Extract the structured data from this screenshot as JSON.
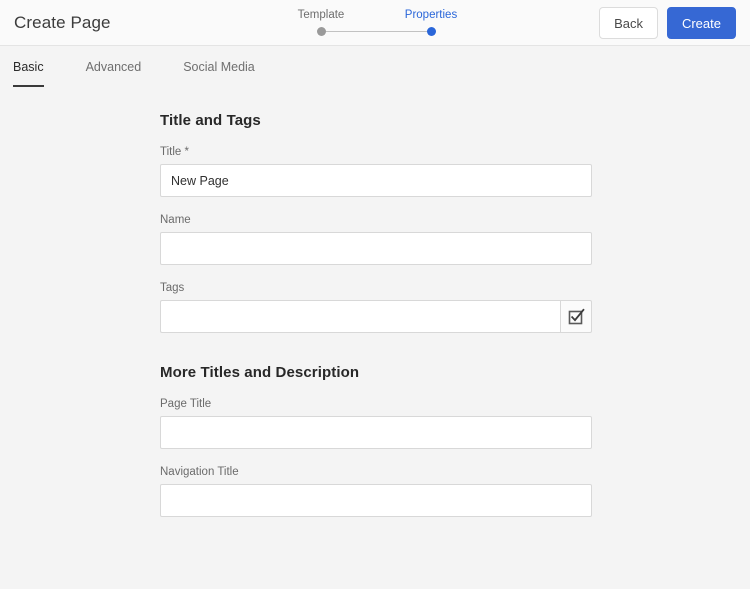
{
  "header": {
    "title": "Create Page",
    "stepper": {
      "steps": [
        {
          "label": "Template",
          "state": "inactive"
        },
        {
          "label": "Properties",
          "state": "active"
        }
      ]
    },
    "actions": {
      "back_label": "Back",
      "create_label": "Create"
    },
    "colors": {
      "primary": "#3668d4",
      "active_step": "#2a66d9",
      "inactive_step": "#9a9a9a"
    }
  },
  "tabs": [
    {
      "label": "Basic",
      "active": true
    },
    {
      "label": "Advanced",
      "active": false
    },
    {
      "label": "Social Media",
      "active": false
    }
  ],
  "form": {
    "sections": [
      {
        "heading": "Title and Tags",
        "fields": [
          {
            "label": "Title *",
            "value": "New Page",
            "placeholder": ""
          },
          {
            "label": "Name",
            "value": "",
            "placeholder": ""
          },
          {
            "label": "Tags",
            "value": "",
            "placeholder": "",
            "trailing_icon": "checkbox-select-icon"
          }
        ]
      },
      {
        "heading": "More Titles and Description",
        "fields": [
          {
            "label": "Page Title",
            "value": "",
            "placeholder": ""
          },
          {
            "label": "Navigation Title",
            "value": "",
            "placeholder": ""
          }
        ]
      }
    ]
  }
}
